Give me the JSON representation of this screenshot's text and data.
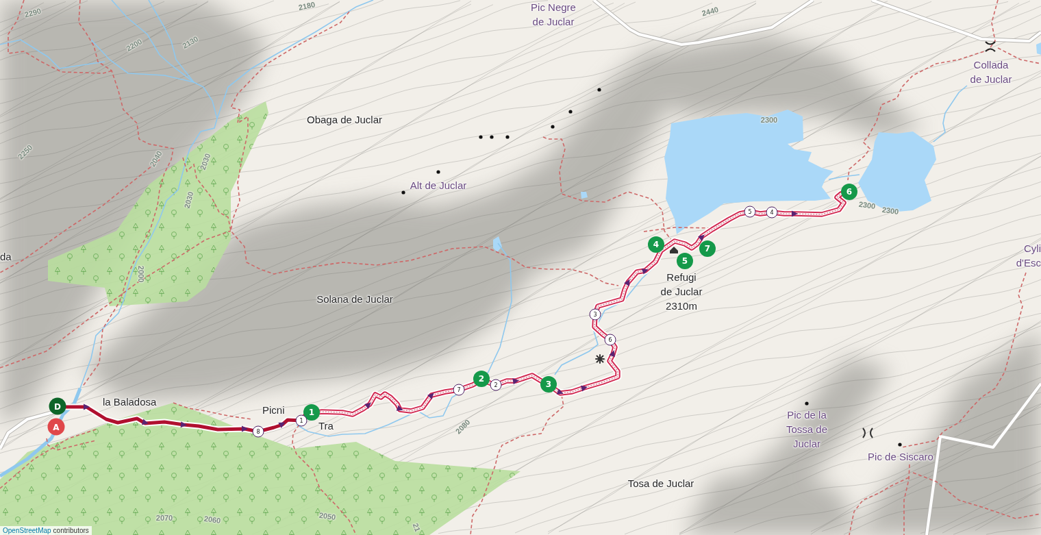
{
  "map": {
    "labels": [
      {
        "kind": "peak",
        "lines": [
          "Pic Negre",
          "de Juclar"
        ]
      },
      {
        "kind": "place",
        "lines": [
          "Obaga de Juclar"
        ]
      },
      {
        "kind": "peak",
        "lines": [
          "Collada",
          "de Juclar"
        ]
      },
      {
        "kind": "peak",
        "lines": [
          "Alt de Juclar"
        ]
      },
      {
        "kind": "place",
        "lines": [
          "da"
        ]
      },
      {
        "kind": "peak",
        "lines": [
          "Cyli",
          "d'Esc"
        ]
      },
      {
        "kind": "place",
        "lines": [
          "Refugi",
          "de Juclar",
          "2310m"
        ]
      },
      {
        "kind": "place",
        "lines": [
          "Solana de Juclar"
        ]
      },
      {
        "kind": "place",
        "lines": [
          "la Baladosa"
        ]
      },
      {
        "kind": "place",
        "lines": [
          "Picni"
        ]
      },
      {
        "kind": "place",
        "lines": [
          "Tra"
        ]
      },
      {
        "kind": "peak",
        "lines": [
          "Pic de la",
          "Tossa de",
          "Juclar"
        ]
      },
      {
        "kind": "peak",
        "lines": [
          "Pic de Siscaro"
        ]
      },
      {
        "kind": "place",
        "lines": [
          "Tosa de Juclar"
        ]
      }
    ],
    "contour_labels": [
      "2290",
      "2200",
      "2130",
      "2180",
      "2250",
      "2040",
      "2030",
      "2030",
      "2000",
      "2440",
      "2300",
      "2300",
      "2300",
      "2080",
      "2070",
      "2060",
      "2050",
      "21"
    ],
    "stage_markers": [
      "1",
      "2",
      "3",
      "4",
      "5",
      "6",
      "7"
    ],
    "waypoint_markers": [
      "1",
      "8",
      "7",
      "2",
      "3",
      "6",
      "5",
      "4"
    ],
    "endpoints": [
      {
        "kind": "start",
        "label": "D"
      },
      {
        "kind": "end",
        "label": "A"
      }
    ],
    "attribution": {
      "link": "OpenStreetMap",
      "text": "contributors"
    }
  }
}
